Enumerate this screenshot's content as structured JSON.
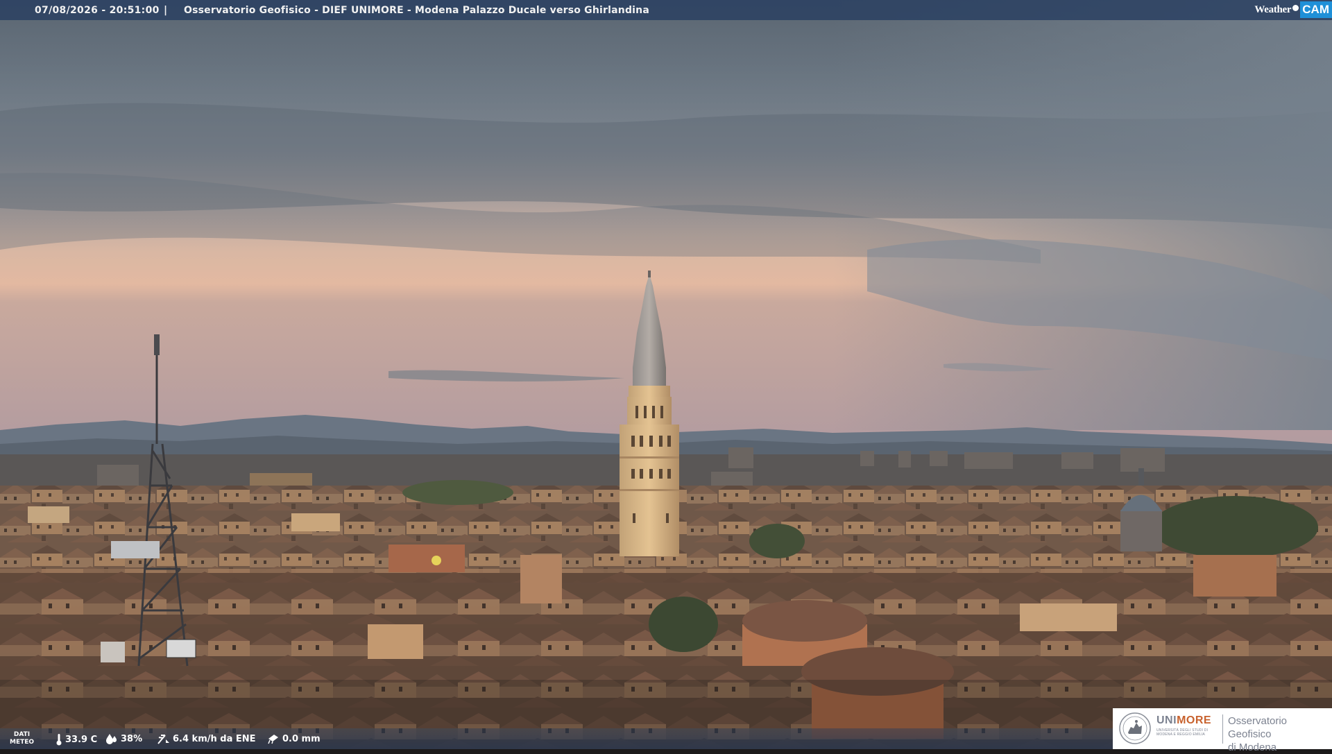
{
  "topbar": {
    "timestamp": "07/08/2026 - 20:51:00",
    "separator": "|",
    "title": "Osservatorio Geofisico - DIEF UNIMORE - Modena Palazzo Ducale verso Ghirlandina"
  },
  "logo": {
    "weather": "Weather",
    "cam": "CAM",
    "accent": "#1f90d8"
  },
  "weather": {
    "dati_line1": "DATI",
    "dati_line2": "METEO",
    "temperature": "33.9 C",
    "humidity": "38%",
    "wind": "6.4 km/h da ENE",
    "rain": "0.0 mm",
    "icons": [
      "thermometer-icon",
      "humidity-drop-icon",
      "wind-icon",
      "rain-gauge-icon"
    ]
  },
  "unimore": {
    "brand_part1": "UNI",
    "brand_part2": "MORE",
    "sub_line1": "UNIVERSITÀ DEGLI STUDI DI",
    "sub_line2": "MODENA E REGGIO EMILIA",
    "observatory_line1": "Osservatorio Geofisico",
    "observatory_line2": "di Modena",
    "colors": {
      "grey": "#7c8290",
      "orange": "#c8622e"
    }
  }
}
